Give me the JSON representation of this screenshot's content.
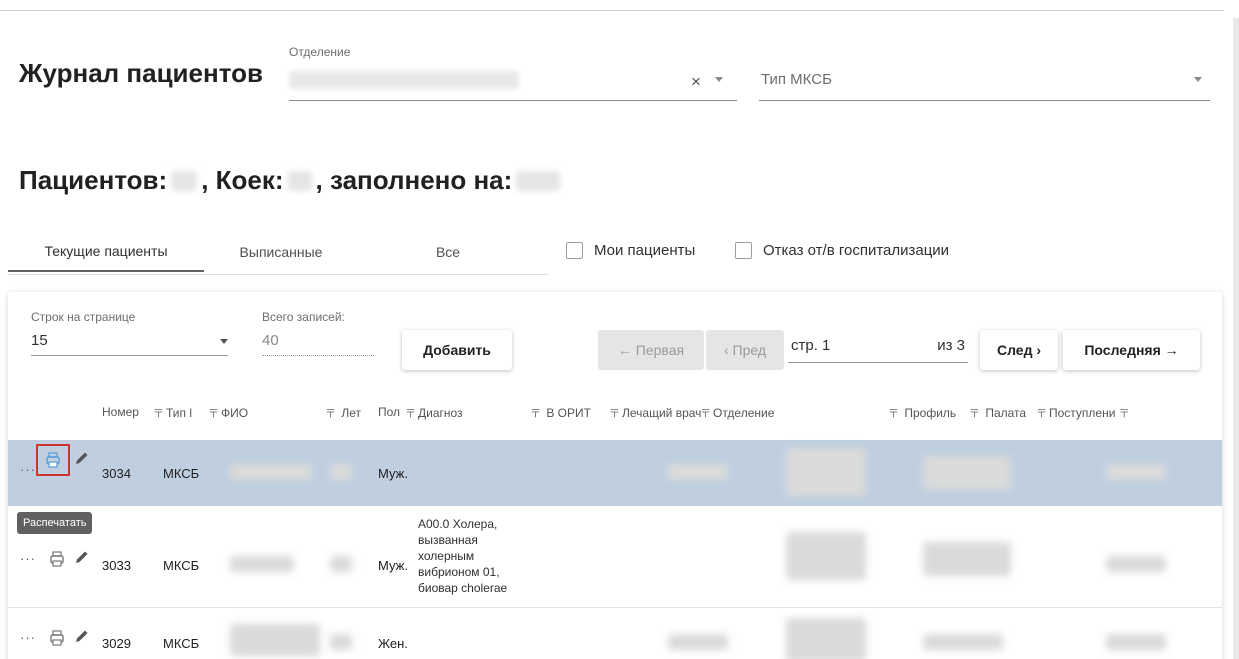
{
  "header": {
    "title": "Журнал пациентов"
  },
  "filters": {
    "department_label": "Отделение",
    "department_clear": "×",
    "mksb_type_placeholder": "Тип МКСБ"
  },
  "stats": {
    "patients_label": "Пациентов:",
    "beds_label": ", Коек:",
    "filled_label": ", заполнено на:"
  },
  "tabs": [
    {
      "label": "Текущие пациенты",
      "active": true
    },
    {
      "label": "Выписанные",
      "active": false
    },
    {
      "label": "Все",
      "active": false
    }
  ],
  "checkboxes": {
    "my_patients": "Мои пациенты",
    "refusal": "Отказ от/в госпитализации"
  },
  "table_controls": {
    "rows_per_page_label": "Строк на странице",
    "rows_per_page_value": "15",
    "total_records_label": "Всего записей:",
    "total_records_value": "40",
    "add_button": "Добавить",
    "first_button": "← Первая",
    "prev_button": "‹ Пред",
    "page_prefix": "стр.  1",
    "page_of": "из 3",
    "next_button": "След ›",
    "last_button": "Последняя →"
  },
  "columns": [
    "Номер",
    "Тип l",
    "ФИО",
    "Лет",
    "Пол",
    "Диагноз",
    "В ОРИТ",
    "Лечащий врач",
    "Отделение",
    "Профиль",
    "Палата",
    "Поступлени"
  ],
  "rows": [
    {
      "number": "3034",
      "type": "МКСБ",
      "sex": "Муж.",
      "diagnosis": "",
      "selected": true
    },
    {
      "number": "3033",
      "type": "МКСБ",
      "sex": "Муж.",
      "diagnosis": "А00.0 Холера, вызванная холерным вибрионом 01, биовар cholerae",
      "selected": false
    },
    {
      "number": "3029",
      "type": "МКСБ",
      "sex": "Жен.",
      "diagnosis": "",
      "selected": false
    }
  ],
  "tooltip": "Распечатать",
  "colors": {
    "selected_row": "#bfcfe0",
    "highlight": "#d32f2f",
    "print_icon_active": "#5a9bd5"
  }
}
